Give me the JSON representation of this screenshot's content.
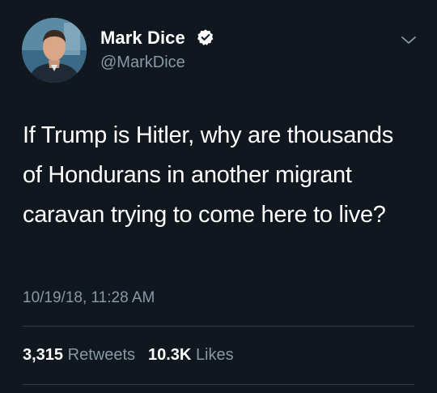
{
  "tweet": {
    "author": {
      "display_name": "Mark Dice",
      "handle": "@MarkDice",
      "verified": true
    },
    "text": "If Trump is Hitler, why are thousands of Hondurans in another migrant caravan trying to come here to live?",
    "timestamp": "10/19/18, 11:28 AM",
    "stats": {
      "retweets_count": "3,315",
      "retweets_label": "Retweets",
      "likes_count": "10.3K",
      "likes_label": "Likes"
    }
  },
  "colors": {
    "background": "#10171e",
    "primary_text": "#ffffff",
    "secondary_text": "#8899a6",
    "divider": "#2f3b47"
  },
  "icons": {
    "verified": "verified-badge-icon",
    "menu": "chevron-down-icon"
  }
}
